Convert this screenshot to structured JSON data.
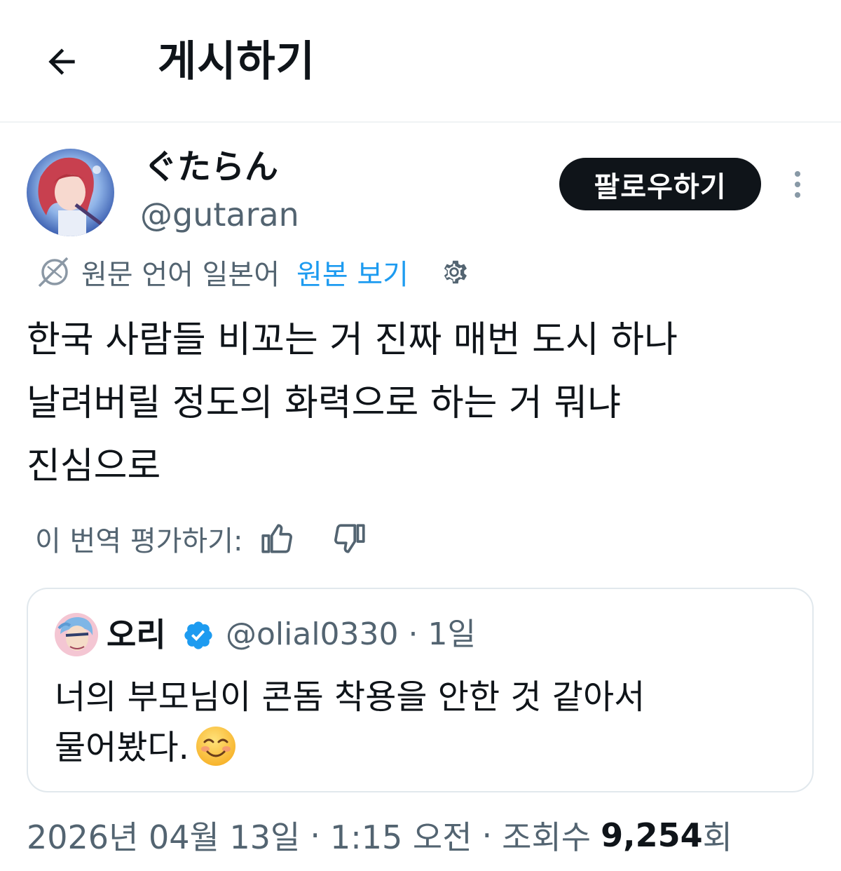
{
  "header": {
    "title": "게시하기"
  },
  "author": {
    "display_name": "ぐたらん",
    "handle": "@gutaran",
    "follow_label": "팔로우하기"
  },
  "translation": {
    "original_language": "원문 언어 일본어",
    "view_original_label": "원본 보기"
  },
  "post": {
    "lines": [
      "한국 사람들 비꼬는 거 진짜 매번 도시 하나",
      "날려버릴 정도의 화력으로 하는 거 뭐냐",
      "진심으로"
    ]
  },
  "rate": {
    "label": "이 번역 평가하기:"
  },
  "quote": {
    "name": "오리",
    "handle_time": "@olial0330 · 1일",
    "lines": [
      "너의 부모님이 콘돔 착용을 안한 것 같아서",
      "물어봤다."
    ]
  },
  "meta": {
    "date": "2026년 04월 13일",
    "time": "1:15 오전",
    "views_label": "조회수",
    "views_count": "9,254",
    "views_suffix": "회",
    "separator": "·"
  },
  "colors": {
    "link": "#1d9bf0",
    "secondary_text": "#536471",
    "primary_text": "#0f1419",
    "follow_bg": "#0f1419",
    "verified": "#1d9bf0"
  }
}
